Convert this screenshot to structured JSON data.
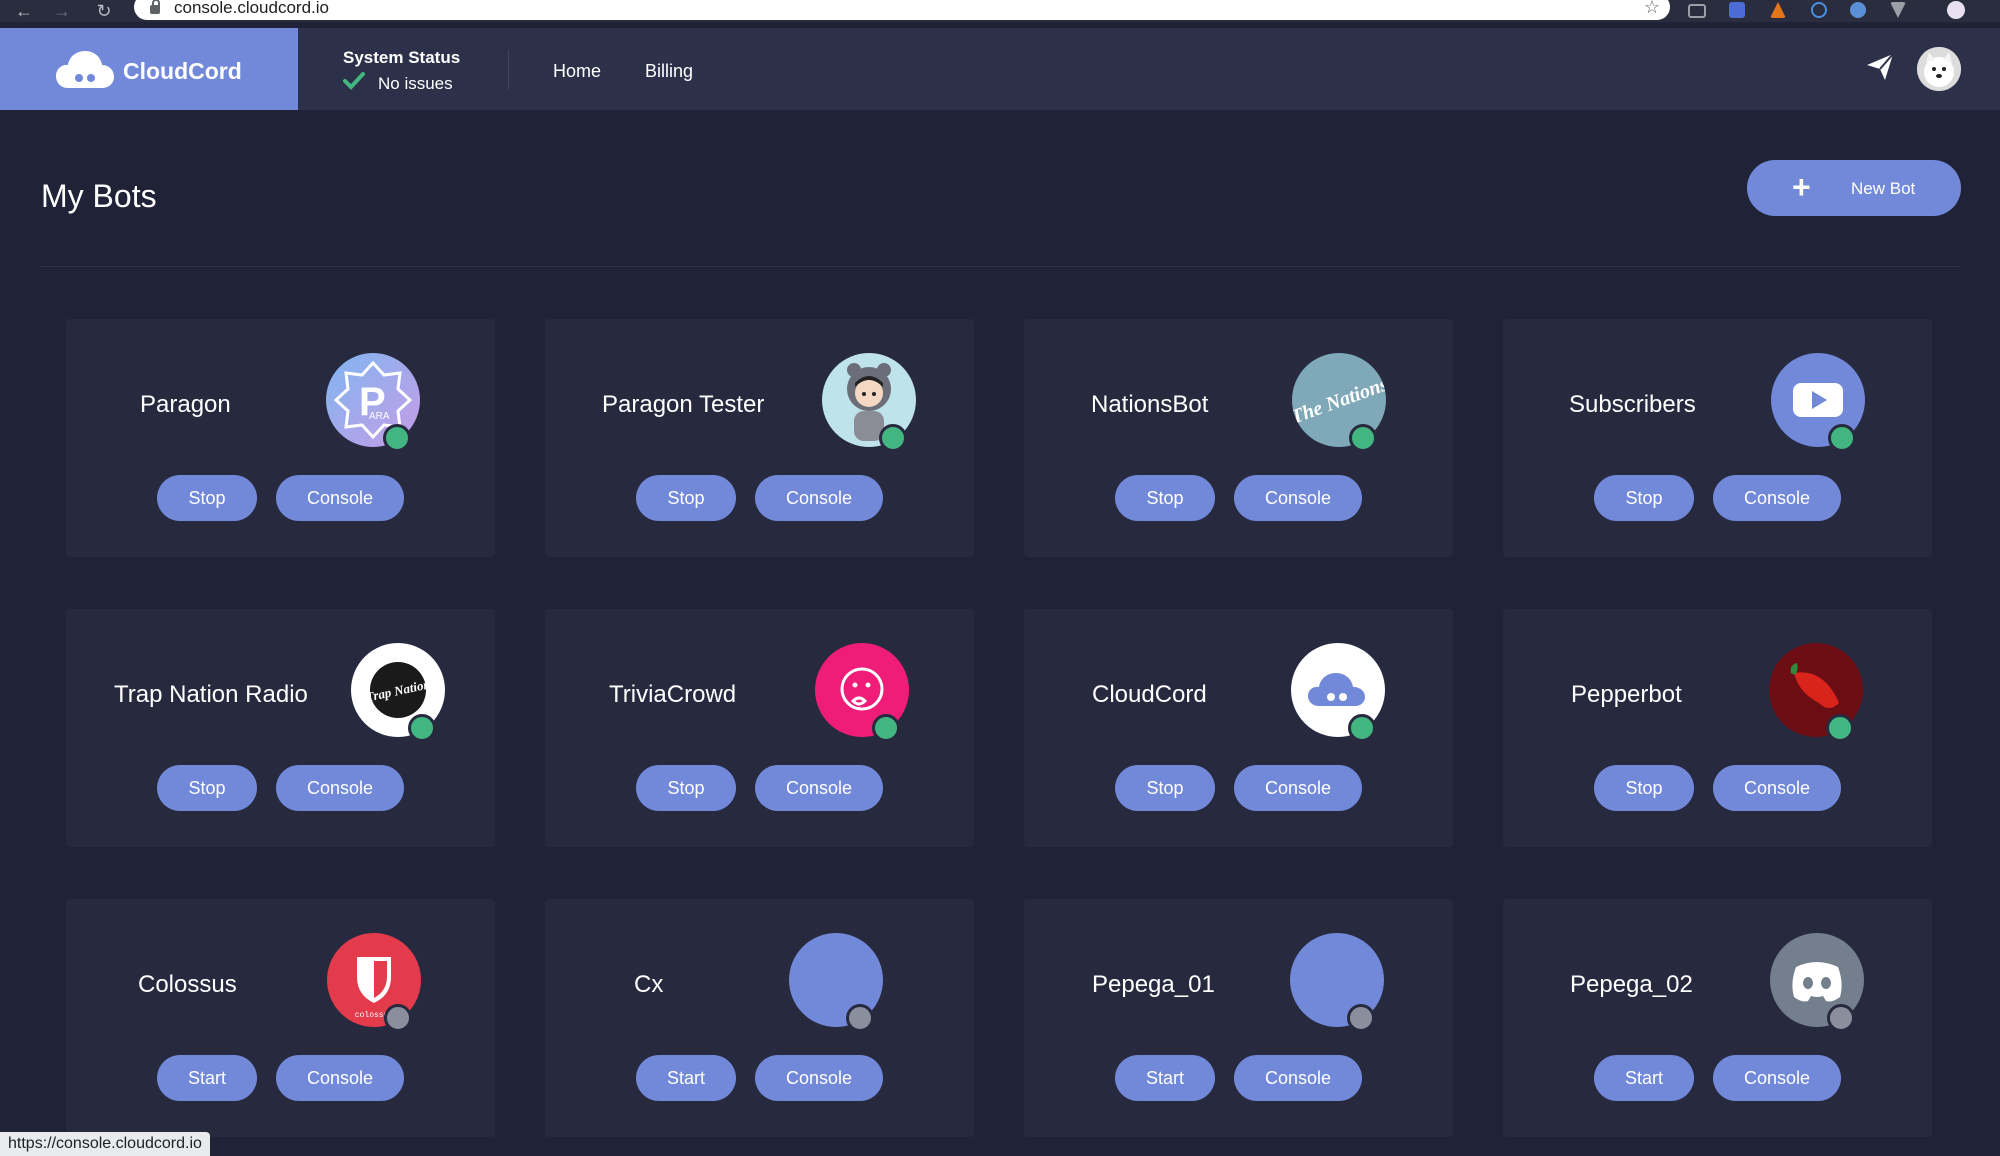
{
  "browser": {
    "url": "console.cloudcord.io"
  },
  "header": {
    "brand": "CloudCord",
    "status_title": "System Status",
    "status_text": "No issues",
    "nav": [
      "Home",
      "Billing"
    ]
  },
  "page": {
    "title": "My Bots",
    "new_bot_label": "New Bot"
  },
  "bots": [
    {
      "name": "Paragon",
      "status": "online",
      "action": "Stop",
      "console": "Console",
      "avatar_text": "ARA"
    },
    {
      "name": "Paragon Tester",
      "status": "online",
      "action": "Stop",
      "console": "Console"
    },
    {
      "name": "NationsBot",
      "status": "online",
      "action": "Stop",
      "console": "Console",
      "avatar_text": "The Nations"
    },
    {
      "name": "Subscribers",
      "status": "online",
      "action": "Stop",
      "console": "Console"
    },
    {
      "name": "Trap Nation Radio",
      "status": "online",
      "action": "Stop",
      "console": "Console",
      "avatar_text": "Trap Nation"
    },
    {
      "name": "TriviaCrowd",
      "status": "online",
      "action": "Stop",
      "console": "Console"
    },
    {
      "name": "CloudCord",
      "status": "online",
      "action": "Stop",
      "console": "Console"
    },
    {
      "name": "Pepperbot",
      "status": "online",
      "action": "Stop",
      "console": "Console"
    },
    {
      "name": "Colossus",
      "status": "offline",
      "action": "Start",
      "console": "Console",
      "avatar_text": "colossus"
    },
    {
      "name": "Cx",
      "status": "offline",
      "action": "Start",
      "console": "Console"
    },
    {
      "name": "Pepega_01",
      "status": "offline",
      "action": "Start",
      "console": "Console"
    },
    {
      "name": "Pepega_02",
      "status": "offline",
      "action": "Start",
      "console": "Console"
    }
  ],
  "statusbar": {
    "url": "https://console.cloudcord.io"
  },
  "colors": {
    "accent": "#7289da",
    "background": "#202337",
    "card": "#272a3f",
    "online": "#43b581",
    "offline": "#8a8f9e"
  }
}
